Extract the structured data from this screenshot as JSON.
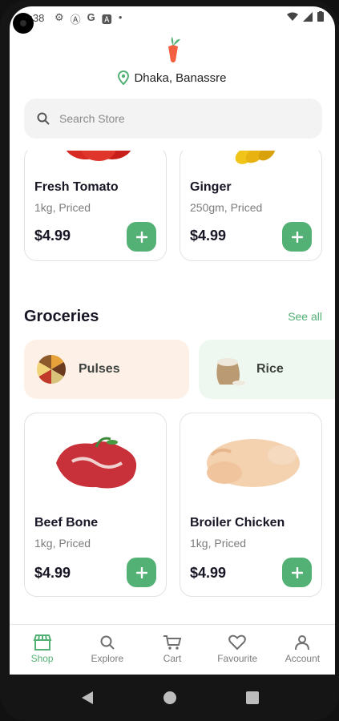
{
  "status_bar": {
    "time": "2:38",
    "left_icons": [
      "gear-icon",
      "a-circle-icon",
      "g-icon",
      "a-square-icon",
      "dot-icon"
    ],
    "right_icons": [
      "wifi-icon",
      "signal-icon",
      "battery-icon"
    ]
  },
  "header": {
    "location": "Dhaka, Banassre"
  },
  "search": {
    "placeholder": "Search Store"
  },
  "top_products": [
    {
      "name": "Fresh Tomato",
      "sub": "1kg, Priced",
      "price": "$4.99"
    },
    {
      "name": "Ginger",
      "sub": "250gm, Priced",
      "price": "$4.99"
    }
  ],
  "groceries": {
    "title": "Groceries",
    "see_all": "See all",
    "categories": [
      {
        "label": "Pulses",
        "color": "#fdf0e7"
      },
      {
        "label": "Rice",
        "color": "#eef8f0"
      }
    ],
    "products": [
      {
        "name": "Beef Bone",
        "sub": "1kg, Priced",
        "price": "$4.99"
      },
      {
        "name": "Broiler Chicken",
        "sub": "1kg, Priced",
        "price": "$4.99"
      }
    ]
  },
  "bottom_nav": [
    {
      "label": "Shop",
      "icon": "store-icon",
      "active": true
    },
    {
      "label": "Explore",
      "icon": "search-icon",
      "active": false
    },
    {
      "label": "Cart",
      "icon": "cart-icon",
      "active": false
    },
    {
      "label": "Favourite",
      "icon": "heart-icon",
      "active": false
    },
    {
      "label": "Account",
      "icon": "user-icon",
      "active": false
    }
  ],
  "colors": {
    "accent": "#53b175",
    "logo": "#f3603f"
  }
}
